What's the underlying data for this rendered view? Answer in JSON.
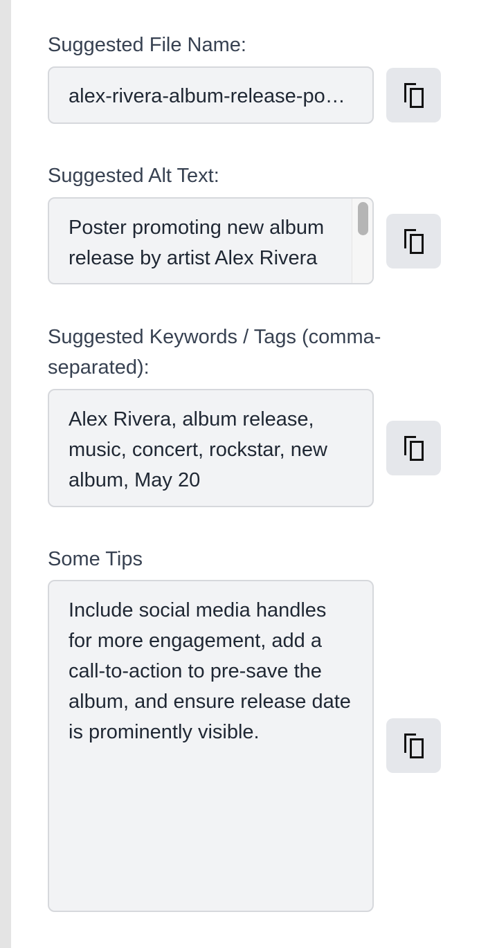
{
  "file_name": {
    "label": "Suggested File Name:",
    "value": "alex-rivera-album-release-poster",
    "copy_icon": "copy-icon"
  },
  "alt_text": {
    "label": "Suggested Alt Text:",
    "value": "Poster promoting new album release by artist Alex Rivera with a rockstar",
    "copy_icon": "copy-icon"
  },
  "keywords": {
    "label": "Suggested Keywords / Tags (comma-separated):",
    "value": "Alex Rivera, album release, music, concert, rockstar, new album, May 20",
    "copy_icon": "copy-icon"
  },
  "tips": {
    "label": "Some Tips",
    "value": "Include social media handles for more engagement, add a call-to-action to pre-save the album, and ensure release date is prominently visible.",
    "copy_icon": "copy-icon"
  }
}
